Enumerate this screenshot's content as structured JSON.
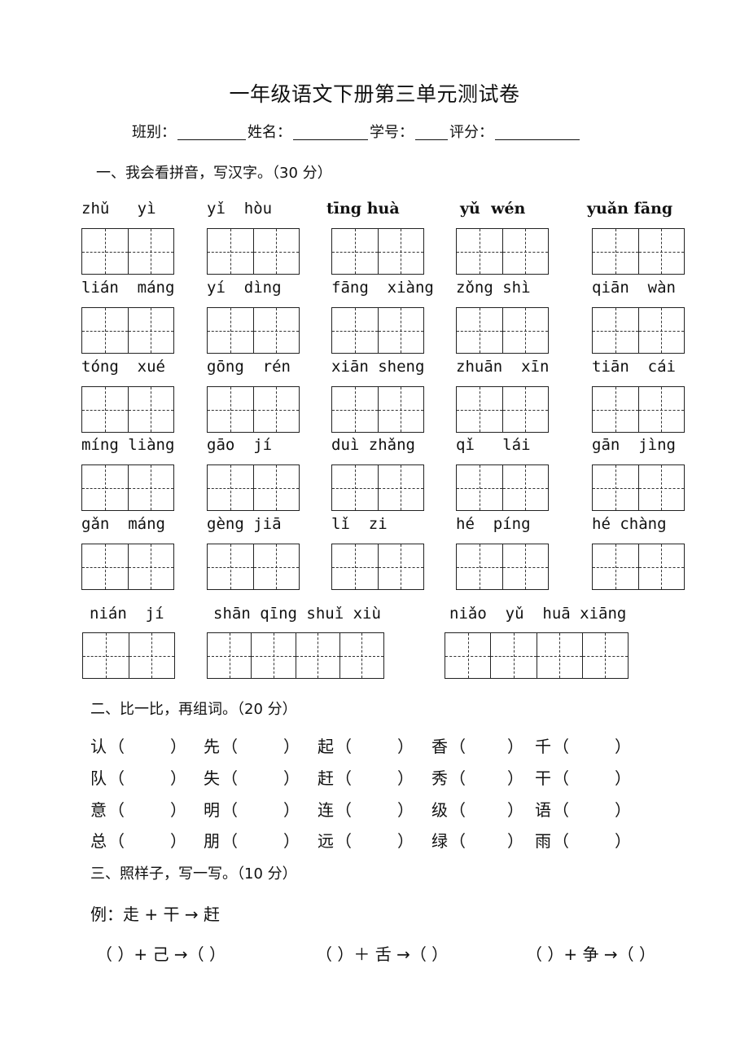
{
  "title": "一年级语文下册第三单元测试卷",
  "info": {
    "class_label": "班别：",
    "name_label": "姓名：",
    "number_label": "学号：",
    "score_label": "评分："
  },
  "section1": {
    "heading": "一、我会看拼音，写汉字。（30 分）",
    "rows": [
      [
        "zhǔ   yì",
        "yǐ  hòu",
        "tīng huà",
        "yǔ  wén",
        "yuǎn fāng"
      ],
      [
        "lián  máng",
        "yí  dìng",
        "fāng  xiàng",
        "zǒng shì",
        "qiān  wàn"
      ],
      [
        "tóng  xué",
        "gōng  rén",
        "xiān sheng",
        "zhuān  xīn",
        "tiān  cái"
      ],
      [
        "míng liàng",
        "gāo  jí",
        "duì zhǎng",
        "qǐ   lái",
        "gān  jìng"
      ],
      [
        "gǎn  máng",
        "gèng jiā",
        "lǐ  zi",
        "hé  píng",
        "hé chàng"
      ]
    ],
    "last_row": [
      "nián  jí",
      "shān qīng shuǐ xiù",
      "niǎo  yǔ  huā xiāng"
    ]
  },
  "section2": {
    "heading": "二、比一比，再组词。（20 分）",
    "rows": [
      [
        "认",
        "先",
        "起",
        "香",
        "千"
      ],
      [
        "队",
        "失",
        "赶",
        "秀",
        "干"
      ],
      [
        "意",
        "明",
        "连",
        "级",
        "语"
      ],
      [
        "总",
        "朋",
        "远",
        "绿",
        "雨"
      ]
    ],
    "paren_open": "（",
    "paren_close": "）"
  },
  "section3": {
    "heading": "三、照样子，写一写。（10 分）",
    "example": "例：走 + 干 → 赶",
    "exercises": [
      "（  ）+ 己 →（   ）",
      "（  ）＋ 舌 →（  ）",
      "（  ）+ 争 →（  ）"
    ]
  }
}
